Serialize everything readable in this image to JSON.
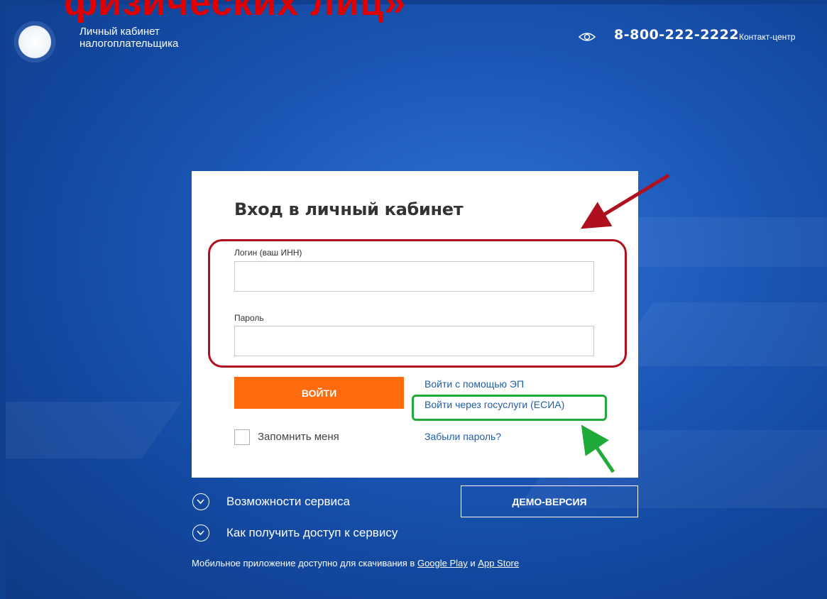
{
  "overlay": {
    "clipped_heading": "физических лиц»"
  },
  "header": {
    "site_title_line1": "Личный кабинет",
    "site_title_line2": "налогоплательщика",
    "phone": "8-800-222-2222",
    "contact_label": "Контакт-центр",
    "icons": {
      "logo": "fns-emblem-logo",
      "accessibility": "eye-icon"
    }
  },
  "login": {
    "title": "Вход в личный кабинет",
    "login_label": "Логин (ваш ИНН)",
    "login_value": "",
    "password_label": "Пароль",
    "password_value": "",
    "submit_label": "ВОЙТИ",
    "ep_link": "Войти с помощью ЭП",
    "esia_link": "Войти через госуслуги (ЕСИА)",
    "remember_label": "Запомнить меня",
    "forgot_link": "Забыли пароль?"
  },
  "below": {
    "features_label": "Возможности сервиса",
    "access_label": "Как получить доступ к сервису",
    "demo_label": "ДЕМО-ВЕРСИЯ",
    "mobile_prefix": "Мобильное приложение доступно для скачивания в",
    "google_play": "Google Play",
    "and_word": "и",
    "app_store": "App Store"
  },
  "colors": {
    "accent_orange": "#ff6a0d",
    "link_blue": "#1f5fa8",
    "annotation_red": "#b0101e",
    "annotation_green": "#1faa3a"
  }
}
